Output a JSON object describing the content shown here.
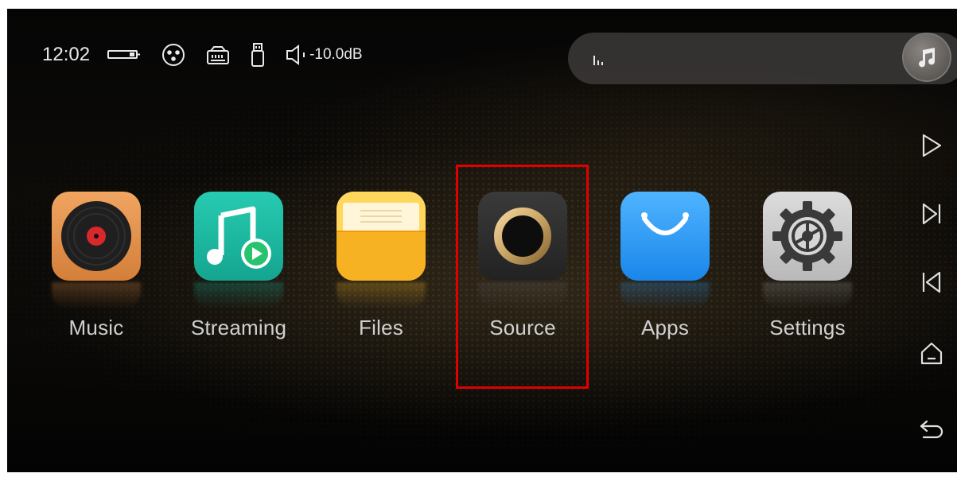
{
  "statusbar": {
    "time": "12:02",
    "icons": [
      "hdmi-icon",
      "xlr-icon",
      "ethernet-icon",
      "usb-icon",
      "speaker-icon"
    ],
    "volume": "-10.0dB"
  },
  "now_playing": {
    "indicator_icon": "level-bars-icon",
    "art_icon": "music-note-icon"
  },
  "apps": [
    {
      "label": "Music",
      "icon": "vinyl-record-icon",
      "color": "#e8934a"
    },
    {
      "label": "Streaming",
      "icon": "music-play-icon",
      "color": "#1fb9a0"
    },
    {
      "label": "Files",
      "icon": "folder-icon",
      "color": "#fbbd2e"
    },
    {
      "label": "Source",
      "icon": "ring-icon",
      "color": "#2c2c2c"
    },
    {
      "label": "Apps",
      "icon": "shopping-bag-icon",
      "color": "#2f9bf5"
    },
    {
      "label": "Settings",
      "icon": "gear-icon",
      "color": "#cbcbcb"
    }
  ],
  "navbar": [
    "play-icon",
    "next-track-icon",
    "previous-track-icon",
    "home-icon",
    "back-icon"
  ],
  "highlight": {
    "target": "Source",
    "color": "#e00000"
  }
}
